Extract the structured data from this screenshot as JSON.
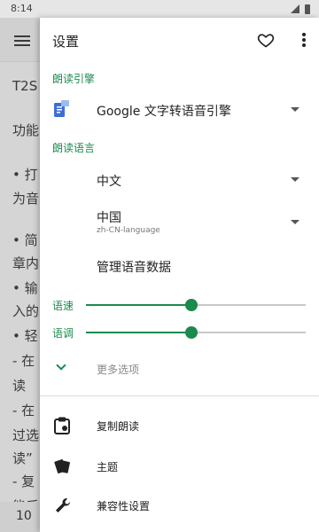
{
  "status_bar": {
    "time": "8:14"
  },
  "background": {
    "lines": [
      "T2S",
      "功能",
      "• 打",
      "为音",
      "• 简",
      "章内",
      "• 输",
      "入的",
      "• 轻",
      "  - 在",
      "读",
      "  - 在",
      "过选",
      "读”",
      "  - 复",
      "能后"
    ],
    "page_number": "10"
  },
  "drawer": {
    "title": "设置",
    "engine_section": "朗读引擎",
    "engine_value": "Google 文字转语音引擎",
    "language_section": "朗读语言",
    "language_value": "中文",
    "region_value": "中国",
    "region_code": "zh-CN-language",
    "manage_voice": "管理语音数据",
    "speed_label": "语速",
    "speed_level": 0.48,
    "pitch_label": "语调",
    "pitch_level": 0.48,
    "more_options": "更多选项",
    "copy_read": "复制朗读",
    "theme": "主题",
    "compat": "兼容性设置"
  },
  "colors": {
    "accent": "#1a8a4e"
  },
  "icons": [
    "menu-icon",
    "heart-icon",
    "more-vert-icon",
    "tts-engine-icon",
    "chevron-down-icon",
    "clipboard-icon",
    "palette-icon",
    "wrench-icon"
  ]
}
